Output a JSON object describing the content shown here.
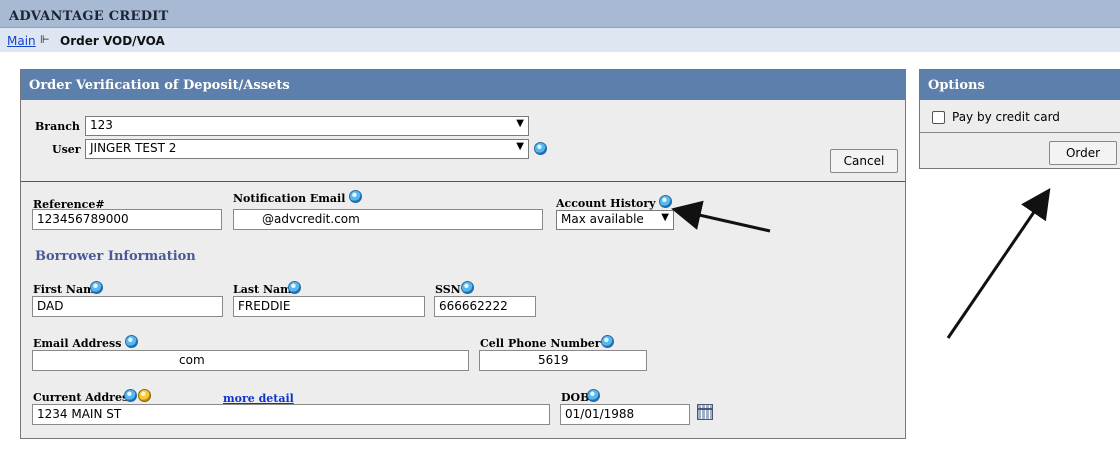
{
  "app": {
    "title": "ADVANTAGE CREDIT"
  },
  "breadcrumb": {
    "main": "Main",
    "separator": "⊩",
    "current": "Order VOD/VOA"
  },
  "order_panel": {
    "title": "Order Verification of Deposit/Assets",
    "branch_label": "Branch",
    "branch_value": "123",
    "user_label": "User",
    "user_value": "JINGER TEST 2",
    "cancel_label": "Cancel",
    "reference_label": "Reference#",
    "reference_value": "123456789000",
    "notification_email_label": "Notification Email",
    "notification_email_value": "@advcredit.com",
    "account_history_label": "Account History",
    "account_history_value": "Max available",
    "borrower_section": "Borrower Information",
    "first_name_label": "First Name",
    "first_name_value": "DAD",
    "last_name_label": "Last Name",
    "last_name_value": "FREDDIE",
    "ssn_label": "SSN",
    "ssn_value": "666662222",
    "email_label": "Email Address",
    "email_value": "com",
    "cell_label": "Cell Phone Number",
    "cell_value": "5619",
    "address_label": "Current Address",
    "more_detail": "more detail",
    "address_value": "1234 MAIN ST",
    "dob_label": "DOB",
    "dob_value": "01/01/1988"
  },
  "options_panel": {
    "title": "Options",
    "pay_by_card_label": "Pay by credit card",
    "pay_by_card_checked": false,
    "order_label": "Order"
  },
  "icons": {
    "help": "help-icon",
    "question": "question-icon",
    "calendar": "calendar-icon",
    "dropdown": "chevron-down-icon"
  },
  "colors": {
    "header_blue": "#5d7fab",
    "top_bar": "#a8b9d3",
    "section_title": "#4a5a98",
    "link": "#1133cc"
  }
}
